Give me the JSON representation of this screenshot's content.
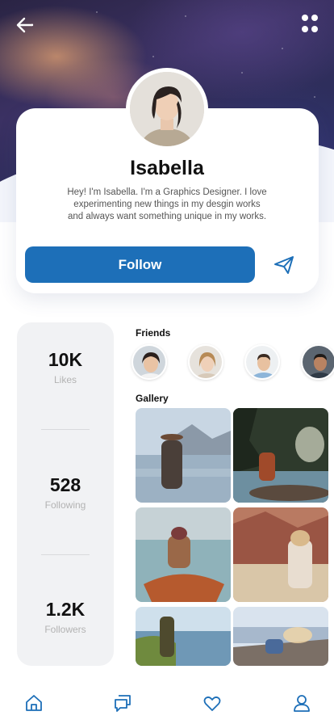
{
  "header": {
    "back_icon": "arrow-left-icon",
    "menu_icon": "grid-dots-icon"
  },
  "profile": {
    "name": "Isabella",
    "bio": "Hey! I'm Isabella. I'm a Graphics Designer. I love experimenting new things in my desgin works and always want something unique in my works.",
    "follow_label": "Follow",
    "send_icon": "paper-plane-icon"
  },
  "stats": [
    {
      "value": "10K",
      "label": "Likes"
    },
    {
      "value": "528",
      "label": "Following"
    },
    {
      "value": "1.2K",
      "label": "Followers"
    }
  ],
  "friends": {
    "title": "Friends"
  },
  "gallery": {
    "title": "Gallery"
  },
  "nav": {
    "items": [
      "home-icon",
      "chat-icon",
      "heart-icon",
      "user-icon"
    ],
    "active_color": "#1d6fb8"
  },
  "colors": {
    "accent": "#1d6fb8"
  }
}
